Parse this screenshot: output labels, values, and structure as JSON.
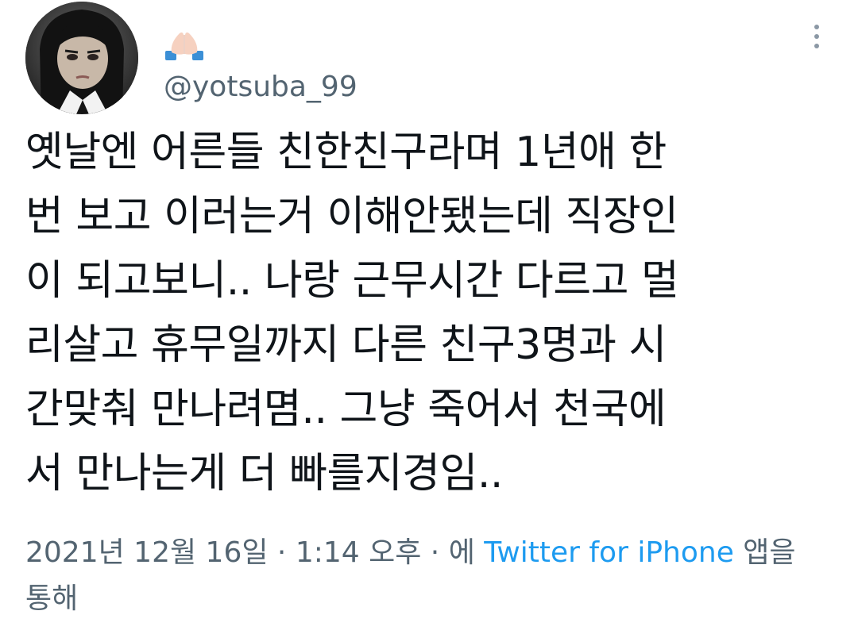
{
  "author": {
    "display_name_emoji": "folded-hands-emoji",
    "handle": "@yotsuba_99"
  },
  "tweet": {
    "text": "옛날엔 어른들 친한친구라며 1년애 한\n번 보고 이러는거 이해안됐는데 직장인\n이 되고보니.. 나랑 근무시간 다르고 멀\n리살고 휴무일까지 다른 친구3명과 시\n간맞춰 만나려몀.. 그냥 죽어서 천국에\n서 만나는게 더 빠를지경임.."
  },
  "meta": {
    "date": "2021년 12월 16일",
    "separator1": " · ",
    "time": "1:14 오후",
    "separator2": " · ",
    "source_prefix": "에 ",
    "source": "Twitter for iPhone",
    "source_suffix": " 앱을 통해"
  },
  "colors": {
    "text": "#0f1419",
    "secondary": "#536471",
    "link": "#1d9bf0"
  },
  "icons": {
    "more": "more-vertical-icon"
  }
}
